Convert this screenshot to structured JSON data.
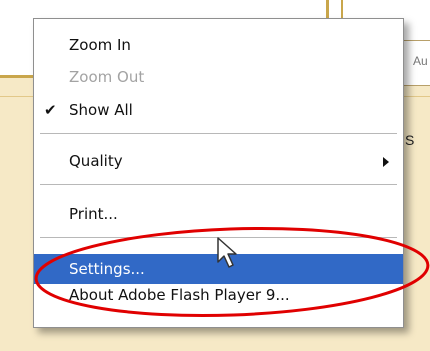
{
  "background": {
    "box_text": "Au",
    "side_letter": "S"
  },
  "context_menu": {
    "items": [
      {
        "label": "Zoom In",
        "enabled": true
      },
      {
        "label": "Zoom Out",
        "enabled": false
      },
      {
        "label": "Show All",
        "enabled": true,
        "checked": true
      },
      {
        "label": "Quality",
        "enabled": true,
        "submenu": true
      },
      {
        "label": "Print...",
        "enabled": true
      },
      {
        "label": "Settings...",
        "enabled": true,
        "selected": true
      },
      {
        "label": "About Adobe Flash Player 9...",
        "enabled": true
      }
    ],
    "check_glyph": "✔",
    "selection_color": "#3169c6"
  },
  "annotation": {
    "color": "#e00000",
    "target": "Settings..."
  }
}
